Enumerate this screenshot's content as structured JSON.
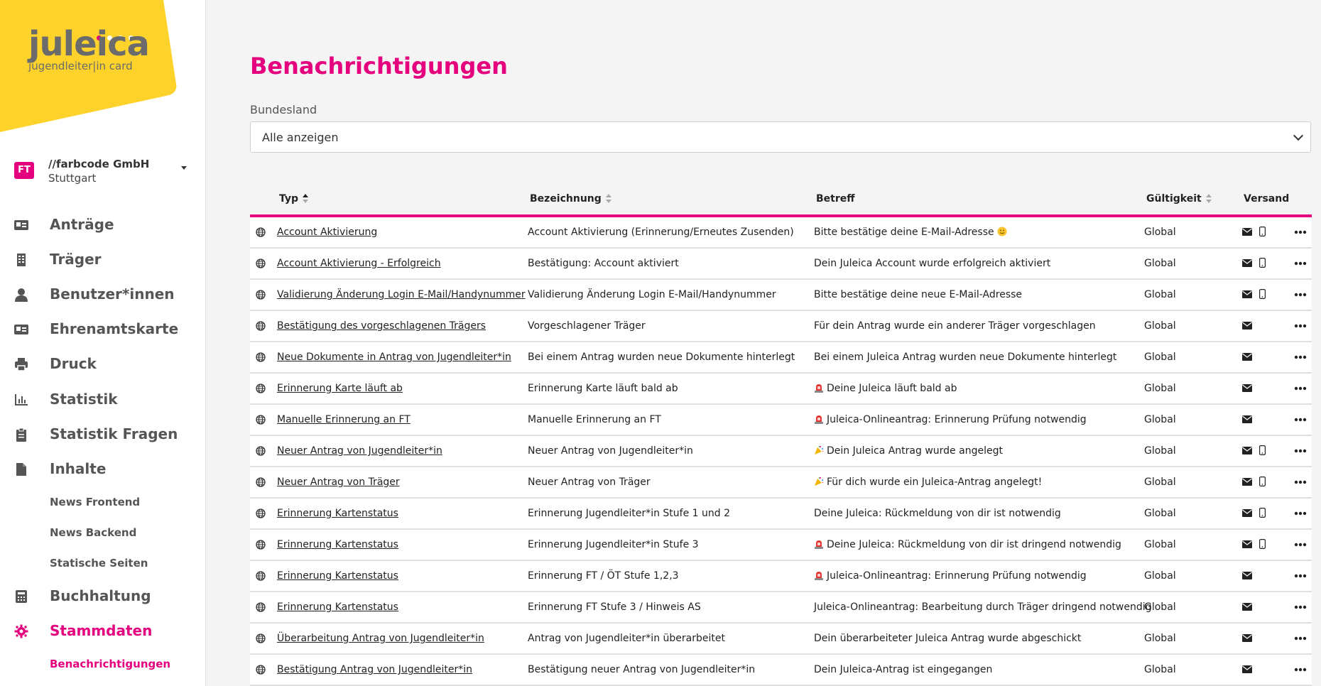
{
  "brand": {
    "name": "juleica",
    "subtitle": "jugendleiter|in card",
    "accent": "#e5007d",
    "logo_bg": "#fdd32b"
  },
  "org": {
    "badge": "FT",
    "name": "//farbcode GmbH",
    "city": "Stuttgart"
  },
  "nav": {
    "items": [
      {
        "label": "Anträge",
        "icon": "id-card-icon"
      },
      {
        "label": "Träger",
        "icon": "building-icon"
      },
      {
        "label": "Benutzer*innen",
        "icon": "user-icon"
      },
      {
        "label": "Ehrenamtskarte",
        "icon": "card-icon"
      },
      {
        "label": "Druck",
        "icon": "printer-icon"
      },
      {
        "label": "Statistik",
        "icon": "bar-chart-icon"
      },
      {
        "label": "Statistik Fragen",
        "icon": "clipboard-icon"
      },
      {
        "label": "Inhalte",
        "icon": "file-icon"
      },
      {
        "label": "Buchhaltung",
        "icon": "calculator-icon"
      },
      {
        "label": "Stammdaten",
        "icon": "gear-icon"
      }
    ],
    "inhalte_sub": [
      "News Frontend",
      "News Backend",
      "Statische Seiten"
    ],
    "stammdaten_sub": [
      "Benachrichtigungen"
    ]
  },
  "page": {
    "title": "Benachrichtigungen"
  },
  "filter": {
    "label": "Bundesland",
    "value": "Alle anzeigen"
  },
  "table": {
    "headers": {
      "typ": "Typ",
      "bezeichnung": "Bezeichnung",
      "betreff": "Betreff",
      "gueltigkeit": "Gültigkeit",
      "versand": "Versand"
    },
    "rows": [
      {
        "typ": "Account Aktivierung",
        "bezeichnung": "Account Aktivierung (Erinnerung/Erneutes Zusenden)",
        "betreff": "Bitte bestätige deine E-Mail-Adresse",
        "emoji_before": "",
        "emoji_after": "smiley",
        "gueltigkeit": "Global",
        "mail": true,
        "phone": true
      },
      {
        "typ": "Account Aktivierung - Erfolgreich",
        "bezeichnung": "Bestätigung: Account aktiviert",
        "betreff": "Dein Juleica Account wurde erfolgreich aktiviert",
        "emoji_before": "",
        "emoji_after": "",
        "gueltigkeit": "Global",
        "mail": true,
        "phone": true
      },
      {
        "typ": "Validierung Änderung Login E-Mail/Handynummer",
        "bezeichnung": "Validierung Änderung Login E-Mail/Handynummer",
        "betreff": "Bitte bestätige deine neue E-Mail-Adresse",
        "emoji_before": "",
        "emoji_after": "",
        "gueltigkeit": "Global",
        "mail": true,
        "phone": true
      },
      {
        "typ": "Bestätigung des vorgeschlagenen Trägers",
        "bezeichnung": "Vorgeschlagener Träger",
        "betreff": "Für dein Antrag wurde ein anderer Träger vorgeschlagen",
        "emoji_before": "",
        "emoji_after": "",
        "gueltigkeit": "Global",
        "mail": true,
        "phone": false
      },
      {
        "typ": "Neue Dokumente in Antrag von Jugendleiter*in",
        "bezeichnung": "Bei einem Antrag wurden neue Dokumente hinterlegt",
        "betreff": "Bei einem Juleica Antrag wurden neue Dokumente hinterlegt",
        "emoji_before": "",
        "emoji_after": "",
        "gueltigkeit": "Global",
        "mail": true,
        "phone": false
      },
      {
        "typ": "Erinnerung Karte läuft ab",
        "bezeichnung": "Erinnerung Karte läuft bald ab",
        "betreff": "Deine Juleica läuft bald ab",
        "emoji_before": "siren",
        "emoji_after": "",
        "gueltigkeit": "Global",
        "mail": true,
        "phone": false
      },
      {
        "typ": "Manuelle Erinnerung an FT",
        "bezeichnung": "Manuelle Erinnerung an FT",
        "betreff": "Juleica-Onlineantrag: Erinnerung Prüfung notwendig",
        "emoji_before": "siren",
        "emoji_after": "",
        "gueltigkeit": "Global",
        "mail": true,
        "phone": false
      },
      {
        "typ": "Neuer Antrag von Jugendleiter*in",
        "bezeichnung": "Neuer Antrag von Jugendleiter*in",
        "betreff": "Dein Juleica Antrag wurde angelegt",
        "emoji_before": "party",
        "emoji_after": "",
        "gueltigkeit": "Global",
        "mail": true,
        "phone": true
      },
      {
        "typ": "Neuer Antrag von Träger",
        "bezeichnung": "Neuer Antrag von Träger",
        "betreff": "Für dich wurde ein Juleica-Antrag angelegt!",
        "emoji_before": "party",
        "emoji_after": "",
        "gueltigkeit": "Global",
        "mail": true,
        "phone": true
      },
      {
        "typ": "Erinnerung Kartenstatus",
        "bezeichnung": "Erinnerung Jugendleiter*in Stufe 1 und 2",
        "betreff": "Deine Juleica: Rückmeldung von dir ist notwendig",
        "emoji_before": "",
        "emoji_after": "",
        "gueltigkeit": "Global",
        "mail": true,
        "phone": true
      },
      {
        "typ": "Erinnerung Kartenstatus",
        "bezeichnung": "Erinnerung Jugendleiter*in Stufe 3",
        "betreff": "Deine Juleica: Rückmeldung von dir ist dringend notwendig",
        "emoji_before": "siren",
        "emoji_after": "",
        "gueltigkeit": "Global",
        "mail": true,
        "phone": true
      },
      {
        "typ": "Erinnerung Kartenstatus",
        "bezeichnung": "Erinnerung FT / ÖT Stufe 1,2,3",
        "betreff": "Juleica-Onlineantrag: Erinnerung Prüfung notwendig",
        "emoji_before": "siren",
        "emoji_after": "",
        "gueltigkeit": "Global",
        "mail": true,
        "phone": false
      },
      {
        "typ": "Erinnerung Kartenstatus",
        "bezeichnung": "Erinnerung FT Stufe 3 / Hinweis AS",
        "betreff": "Juleica-Onlineantrag: Bearbeitung durch Träger dringend notwendig",
        "emoji_before": "",
        "emoji_after": "",
        "gueltigkeit": "Global",
        "mail": true,
        "phone": false
      },
      {
        "typ": "Überarbeitung Antrag von Jugendleiter*in",
        "bezeichnung": "Antrag von Jugendleiter*in überarbeitet",
        "betreff": "Dein überarbeiteter Juleica Antrag wurde abgeschickt",
        "emoji_before": "",
        "emoji_after": "",
        "gueltigkeit": "Global",
        "mail": true,
        "phone": false
      },
      {
        "typ": "Bestätigung Antrag von Jugendleiter*in",
        "bezeichnung": "Bestätigung neuer Antrag von Jugendleiter*in",
        "betreff": "Dein Juleica-Antrag ist eingegangen",
        "emoji_before": "",
        "emoji_after": "",
        "gueltigkeit": "Global",
        "mail": true,
        "phone": false
      }
    ]
  }
}
